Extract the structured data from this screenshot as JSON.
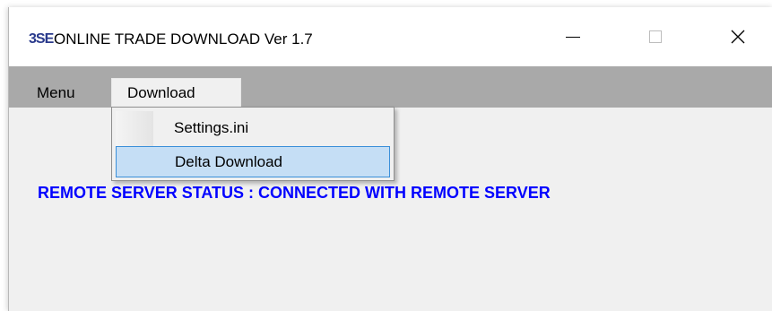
{
  "window": {
    "icon_text": "3SE",
    "title": "ONLINE TRADE DOWNLOAD Ver 1.7"
  },
  "menubar": {
    "items": [
      {
        "label": "Menu"
      },
      {
        "label": "Download"
      }
    ]
  },
  "dropdown": {
    "items": [
      {
        "label": "Settings.ini",
        "highlighted": false
      },
      {
        "label": "Delta Download",
        "highlighted": true
      }
    ]
  },
  "main": {
    "status": "REMOTE SERVER STATUS : CONNECTED WITH REMOTE SERVER"
  },
  "colors": {
    "status_text": "#0000ff",
    "menubar": "#a9a9a9",
    "highlight_fill": "#c5def5",
    "highlight_border": "#3b8fd9"
  }
}
